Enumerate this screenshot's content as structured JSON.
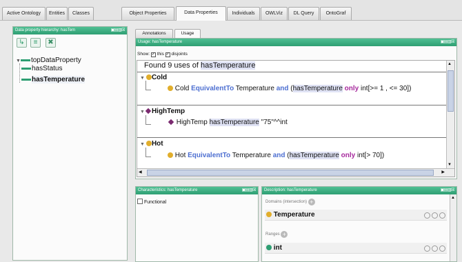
{
  "tabs": [
    "Active Ontology",
    "Entities",
    "Classes",
    "Object Properties",
    "Data Properties",
    "Individuals",
    "OWLViz",
    "DL Query",
    "OntoGraf"
  ],
  "active_tab": "Data Properties",
  "hierarchy": {
    "title": "Data property hierarchy: hasTem",
    "title_controls": "▣▤▥☒",
    "toolbar": {
      "add_sub_icon": "add-subproperty-icon",
      "add_sibling_icon": "add-sibling-icon",
      "delete_icon": "delete-property-icon"
    },
    "root": "topDataProperty",
    "children": [
      "hasStatus",
      "hasTemperature"
    ],
    "selected": "hasTemperature"
  },
  "usage_panel": {
    "subtabs": [
      "Annotations",
      "Usage"
    ],
    "active_subtab": "Usage",
    "title": "Usage: hasTemperature",
    "title_controls": "▣▤▥☒",
    "show_label": "Show:",
    "show_this_label": "this",
    "show_disjoints_label": "disjoints",
    "found_prefix": "Found 9 uses of ",
    "found_entity": "hasTemperature",
    "items": [
      {
        "name": "Cold",
        "icon": "class-icon",
        "axiom": {
          "subject": "Cold",
          "keyword": "EquivalentTo",
          "class": "Temperature",
          "and": "and",
          "open": "(",
          "property": "hasTemperature",
          "only": "only",
          "restriction": "int[>= 1 , <= 30])"
        }
      },
      {
        "name": "HighTemp",
        "icon": "individual-icon",
        "axiom": {
          "subject": "HighTemp",
          "property": "hasTemperature",
          "value": "\"75\"^^int"
        }
      },
      {
        "name": "Hot",
        "icon": "class-icon",
        "axiom": {
          "subject": "Hot",
          "keyword": "EquivalentTo",
          "class": "Temperature",
          "and": "and",
          "open": "(",
          "property": "hasTemperature",
          "only": "only",
          "restriction": "int[> 70])"
        }
      }
    ]
  },
  "characteristics": {
    "title": "Characteristics: hasTemperature",
    "title_controls": "▣▤▥☒",
    "functional_label": "Functional",
    "functional_checked": false
  },
  "description": {
    "title": "Description: hasTemperature",
    "title_controls": "▣▤▥☒",
    "domains_label": "Domains (intersection)",
    "domain_value": "Temperature",
    "ranges_label": "Ranges",
    "range_value": "int"
  },
  "colors": {
    "title_green": "#2e9e72",
    "class_yellow": "#e1ae2c",
    "individual_purple": "#7a2a6f",
    "keyword_blue": "#4d6fd1",
    "keyword_magenta": "#a6289c",
    "highlight": "#dfe2f4"
  }
}
